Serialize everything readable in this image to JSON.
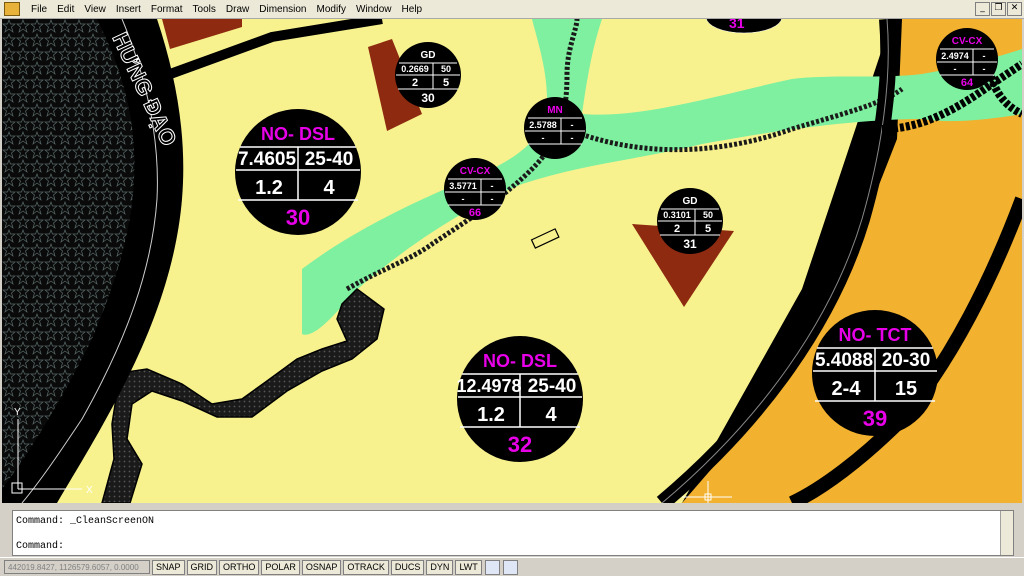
{
  "menus": [
    "File",
    "Edit",
    "View",
    "Insert",
    "Format",
    "Tools",
    "Draw",
    "Dimension",
    "Modify",
    "Window",
    "Help"
  ],
  "window_controls": [
    "_",
    "❐",
    "✕"
  ],
  "map": {
    "street_name": "HƯNG ĐẠO",
    "partial_tag": "31",
    "big_tags": [
      {
        "code": "NO- DSL",
        "area": "7.4605",
        "floors": "25-40",
        "coverage": "1.2",
        "ratio": "4",
        "lot": "30"
      },
      {
        "code": "NO- DSL",
        "area": "12.4978",
        "floors": "25-40",
        "coverage": "1.2",
        "ratio": "4",
        "lot": "32"
      },
      {
        "code": "NO- TCT",
        "area": "5.4088",
        "floors": "20-30",
        "coverage": "2-4",
        "ratio": "15",
        "lot": "39"
      }
    ],
    "small_tags": [
      {
        "code": "GD",
        "area": "0.2669",
        "floors": "50",
        "coverage": "2",
        "ratio": "5",
        "lot": "30"
      },
      {
        "code": "MN",
        "area": "2.5788",
        "floors": "-",
        "coverage": "-",
        "ratio": "-",
        "lot": ""
      },
      {
        "code": "CV-CX",
        "area": "3.5771",
        "floors": "-",
        "coverage": "-",
        "ratio": "-",
        "lot": "66"
      },
      {
        "code": "GD",
        "area": "0.3101",
        "floors": "50",
        "coverage": "2",
        "ratio": "5",
        "lot": "31"
      },
      {
        "code": "CV-CX",
        "area": "2.4974",
        "floors": "-",
        "coverage": "-",
        "ratio": "-",
        "lot": "64"
      }
    ],
    "axis": {
      "y": "Y",
      "x": "X"
    },
    "colors": {
      "residential": "#f7f28e",
      "green": "#7ef0a0",
      "commercial": "#f2b12e",
      "school": "#8e2a10",
      "road": "#000000",
      "tag_label": "#e800e8",
      "tag_text": "#ffffff"
    }
  },
  "command": {
    "history": "Command:  _CleanScreenON",
    "prompt": "Command:"
  },
  "status": {
    "coords": "442019.8427, 1126579.6057, 0.0000",
    "toggles": [
      "SNAP",
      "GRID",
      "ORTHO",
      "POLAR",
      "OSNAP",
      "OTRACK",
      "DUCS",
      "DYN",
      "LWT"
    ]
  }
}
